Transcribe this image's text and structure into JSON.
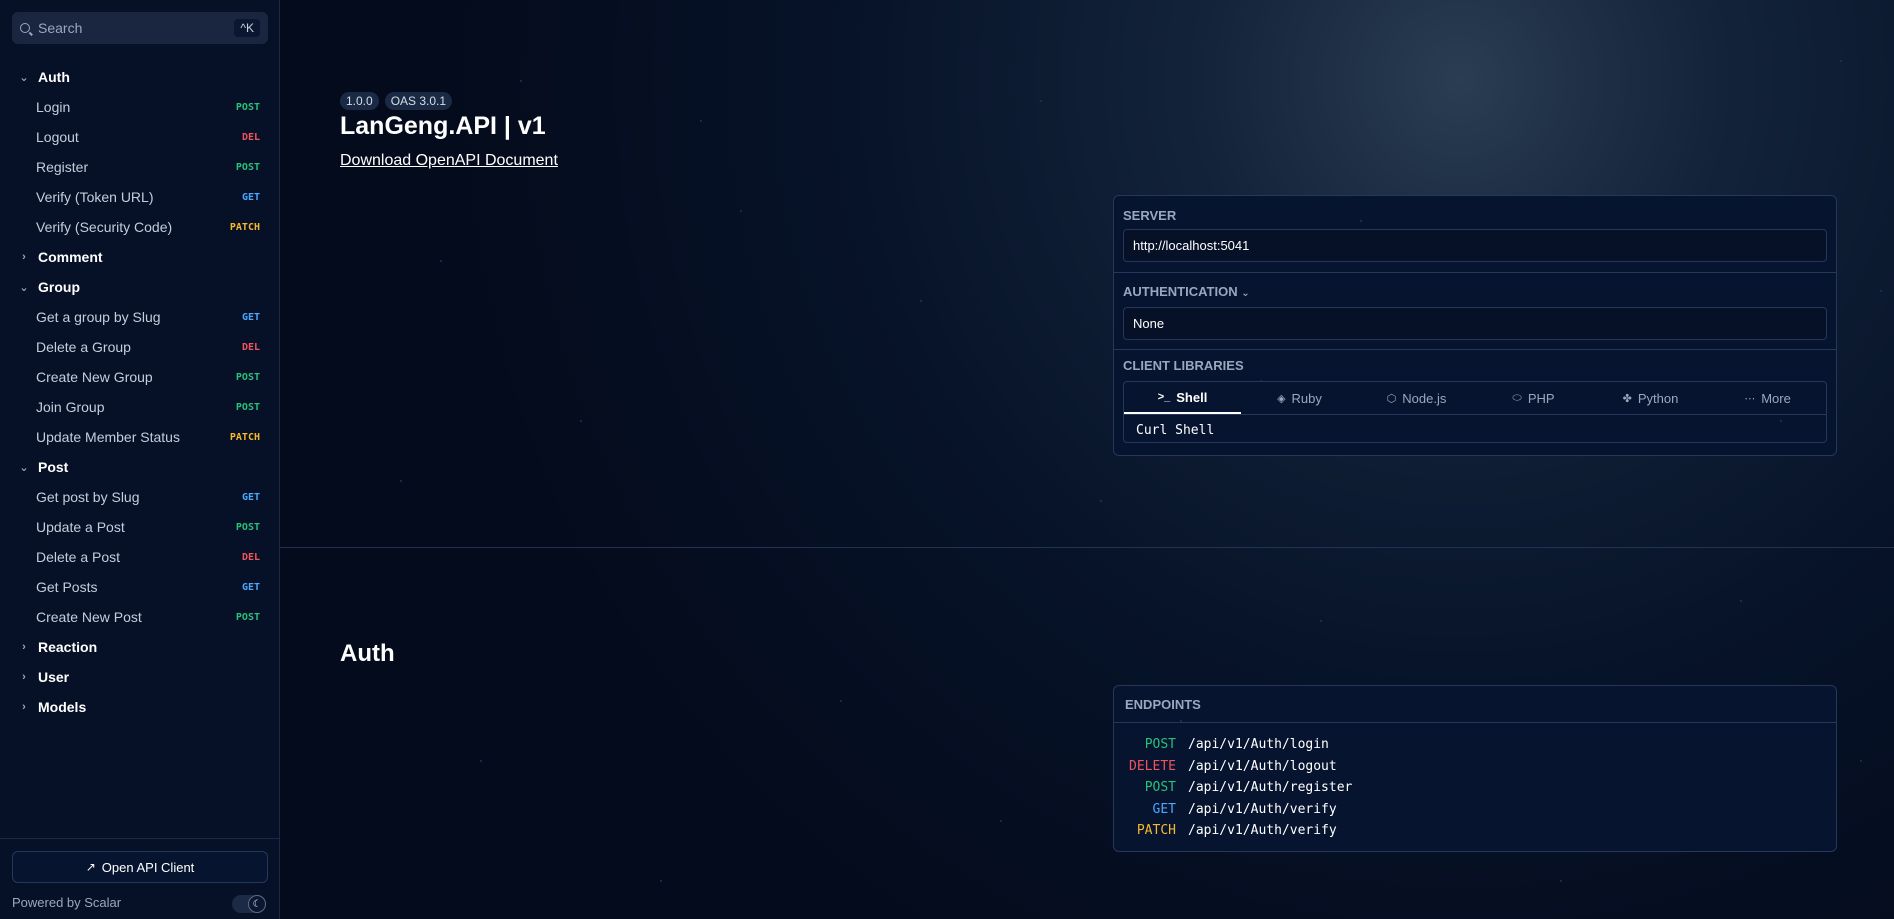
{
  "search": {
    "placeholder": "Search",
    "shortcut": "^K"
  },
  "sidebar": {
    "groups": [
      {
        "label": "Auth",
        "expanded": true,
        "items": [
          {
            "label": "Login",
            "method": "POST"
          },
          {
            "label": "Logout",
            "method": "DEL"
          },
          {
            "label": "Register",
            "method": "POST"
          },
          {
            "label": "Verify (Token URL)",
            "method": "GET"
          },
          {
            "label": "Verify (Security Code)",
            "method": "PATCH"
          }
        ]
      },
      {
        "label": "Comment",
        "expanded": false,
        "items": []
      },
      {
        "label": "Group",
        "expanded": true,
        "items": [
          {
            "label": "Get a group by Slug",
            "method": "GET"
          },
          {
            "label": "Delete a Group",
            "method": "DEL"
          },
          {
            "label": "Create New Group",
            "method": "POST"
          },
          {
            "label": "Join Group",
            "method": "POST"
          },
          {
            "label": "Update Member Status",
            "method": "PATCH"
          }
        ]
      },
      {
        "label": "Post",
        "expanded": true,
        "items": [
          {
            "label": "Get post by Slug",
            "method": "GET"
          },
          {
            "label": "Update a Post",
            "method": "POST"
          },
          {
            "label": "Delete a Post",
            "method": "DEL"
          },
          {
            "label": "Get Posts",
            "method": "GET"
          },
          {
            "label": "Create New Post",
            "method": "POST"
          }
        ]
      },
      {
        "label": "Reaction",
        "expanded": false,
        "items": []
      },
      {
        "label": "User",
        "expanded": false,
        "items": []
      },
      {
        "label": "Models",
        "expanded": false,
        "items": []
      }
    ],
    "footer": {
      "open_client": "Open API Client",
      "powered_by": "Powered by Scalar"
    }
  },
  "header": {
    "version_badge": "1.0.0",
    "oas_badge": "OAS 3.0.1",
    "title": "LanGeng.API | v1",
    "download_link": "Download OpenAPI Document"
  },
  "config_panel": {
    "server_label": "SERVER",
    "server_value": "http://localhost:5041",
    "auth_label": "AUTHENTICATION",
    "auth_value": "None",
    "client_libraries_label": "CLIENT LIBRARIES",
    "tabs": [
      {
        "label": "Shell",
        "icon": "terminal-icon",
        "glyph": ">_",
        "active": true
      },
      {
        "label": "Ruby",
        "icon": "ruby-icon",
        "glyph": "◈",
        "active": false
      },
      {
        "label": "Node.js",
        "icon": "nodejs-icon",
        "glyph": "⬡",
        "active": false
      },
      {
        "label": "PHP",
        "icon": "php-icon",
        "glyph": "⬭",
        "active": false
      },
      {
        "label": "Python",
        "icon": "python-icon",
        "glyph": "✤",
        "active": false
      },
      {
        "label": "More",
        "icon": "more-icon",
        "glyph": "⋯",
        "active": false
      }
    ],
    "selected_client": "Curl Shell"
  },
  "section": {
    "title": "Auth",
    "endpoints_label": "ENDPOINTS",
    "endpoints": [
      {
        "method": "POST",
        "path": "/api/v1/Auth/login"
      },
      {
        "method": "DELETE",
        "path": "/api/v1/Auth/logout"
      },
      {
        "method": "POST",
        "path": "/api/v1/Auth/register"
      },
      {
        "method": "GET",
        "path": "/api/v1/Auth/verify"
      },
      {
        "method": "PATCH",
        "path": "/api/v1/Auth/verify"
      }
    ]
  },
  "colors": {
    "post": "#27c17a",
    "delete": "#f2545b",
    "get": "#4aa8ff",
    "patch": "#f5b82e"
  }
}
